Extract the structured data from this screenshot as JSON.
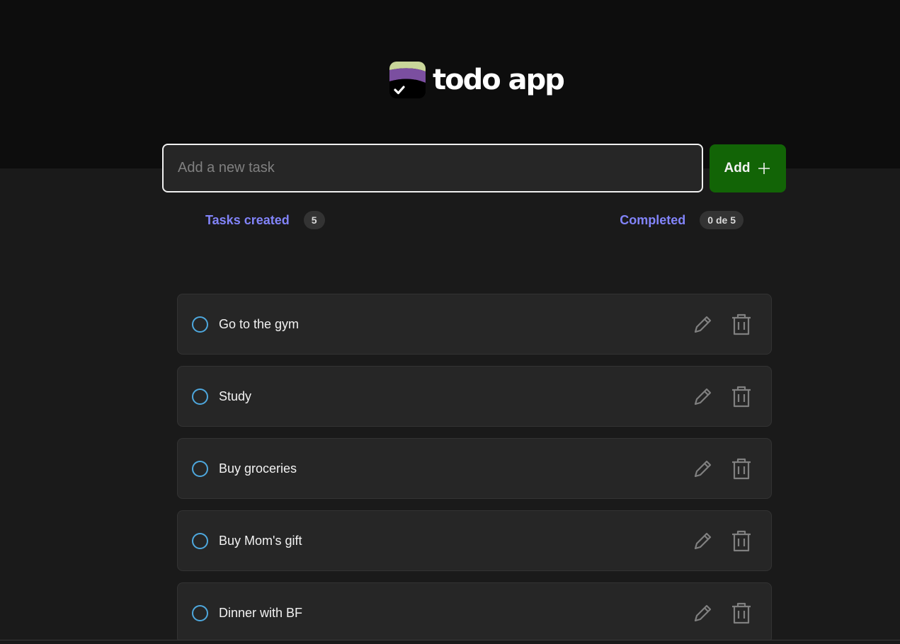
{
  "app": {
    "logo_text": "todo app",
    "logo_icon": "checkmark-stack-logo"
  },
  "input": {
    "placeholder": "Add a new task",
    "value": ""
  },
  "add_button": {
    "label": "Add",
    "icon": "plus-icon"
  },
  "counters": {
    "created_label": "Tasks created",
    "created_count": "5",
    "completed_label": "Completed",
    "completed_count": "0 de 5"
  },
  "tasks": [
    {
      "text": "Go to the gym",
      "completed": false
    },
    {
      "text": "Study",
      "completed": false
    },
    {
      "text": "Buy groceries",
      "completed": false
    },
    {
      "text": "Buy Mom's gift",
      "completed": false
    },
    {
      "text": "Dinner with BF",
      "completed": false
    }
  ],
  "colors": {
    "header_bg": "#0d0d0d",
    "page_bg": "#1a1a1a",
    "add_button": "#126406",
    "counter_label": "#8284fa",
    "checkbox": "#4ea8de",
    "card_bg": "#262626"
  }
}
